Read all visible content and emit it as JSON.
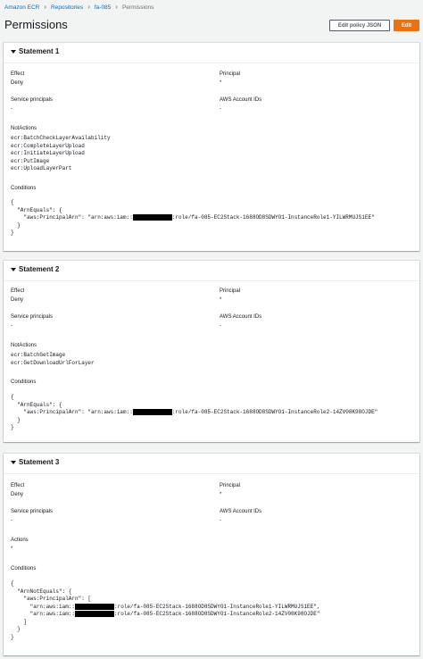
{
  "breadcrumb": {
    "items": [
      "Amazon ECR",
      "Repositories",
      "fa-085"
    ],
    "current": "Permissions"
  },
  "page": {
    "title": "Permissions",
    "edit_policy_label": "Edit policy JSON",
    "edit_label": "Edit"
  },
  "labels": {
    "effect": "Effect",
    "principal": "Principal",
    "service_principals": "Service principals",
    "aws_account_ids": "AWS Account IDs",
    "not_actions": "NotActions",
    "actions": "Actions",
    "conditions": "Conditions"
  },
  "statements": [
    {
      "title": "Statement 1",
      "effect": "Deny",
      "principal": "*",
      "service_principals": "-",
      "aws_account_ids": "-",
      "not_actions": [
        "ecr:BatchCheckLayerAvailability",
        "ecr:CompleteLayerUpload",
        "ecr:InitiateLayerUpload",
        "ecr:PutImage",
        "ecr:UploadLayerPart"
      ],
      "conditions": {
        "open": "{",
        "l1": "  \"ArnEquals\": {",
        "l2_pre": "    \"aws:PrincipalArn\": \"arn:aws:iam::",
        "l2_post": ":role/fa-085-EC2Stack-1688OD8SDWYO1-InstanceRole1-YILWRMUJS1EE\"",
        "l3": "  }",
        "close": "}"
      }
    },
    {
      "title": "Statement 2",
      "effect": "Deny",
      "principal": "*",
      "service_principals": "-",
      "aws_account_ids": "-",
      "not_actions": [
        "ecr:BatchGetImage",
        "ecr:GetDownloadUrlForLayer"
      ],
      "conditions": {
        "open": "{",
        "l1": "  \"ArnEquals\": {",
        "l2_pre": "    \"aws:PrincipalArn\": \"arn:aws:iam::",
        "l2_post": ":role/fa-085-EC2Stack-1688OD8SDWYO1-InstanceRole2-14ZV08K98OJDE\"",
        "l3": "  }",
        "close": "}"
      }
    },
    {
      "title": "Statement 3",
      "effect": "Deny",
      "principal": "*",
      "service_principals": "-",
      "aws_account_ids": "-",
      "actions": "*",
      "conditions": {
        "open": "{",
        "l1": "  \"ArnNotEquals\": {",
        "l2": "    \"aws:PrincipalArn\": [",
        "l3_pre": "      \"arn:aws:iam::",
        "l3_post": ":role/fa-085-EC2Stack-1688OD8SDWYO1-InstanceRole1-YILWRMUJS1EE\",",
        "l4_pre": "      \"arn:aws:iam::",
        "l4_post": ":role/fa-085-EC2Stack-1688OD8SDWYO1-InstanceRole2-14ZV08K98OJDE\"",
        "l5": "    ]",
        "l6": "  }",
        "close": "}"
      }
    }
  ],
  "colors": {
    "link": "#0073bb",
    "primary_button": "#ec7211",
    "background": "#f2f3f3"
  }
}
